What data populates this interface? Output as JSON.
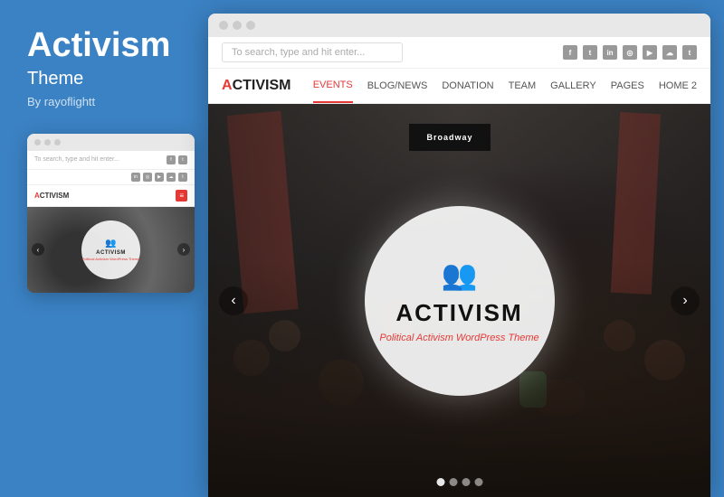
{
  "left_panel": {
    "title": "Activism",
    "subtitle": "Theme",
    "author": "By rayoflightt"
  },
  "mini_browser": {
    "dots": [
      "dot1",
      "dot2",
      "dot3"
    ],
    "search_placeholder": "To search, type and hit enter...",
    "logo": "ACTIVISM",
    "logo_accent": "A",
    "nav_label": "≡",
    "hero": {
      "title": "ACTIVISM",
      "subtitle": "Political Activism WordPress Theme",
      "icon": "👥"
    },
    "arrow_left": "‹",
    "arrow_right": "›"
  },
  "browser": {
    "dots": [
      "dot1",
      "dot2",
      "dot3"
    ],
    "search_placeholder": "To search, type and hit enter...",
    "social_icons": [
      "f",
      "t",
      "in",
      "◎",
      "▶",
      "⬛",
      "t"
    ],
    "logo": "ACTIVISM",
    "logo_accent": "A",
    "nav_links": [
      {
        "label": "EVENTS",
        "active": true
      },
      {
        "label": "BLOG/NEWS",
        "active": false
      },
      {
        "label": "DONATION",
        "active": false
      },
      {
        "label": "TEAM",
        "active": false
      },
      {
        "label": "GALLERY",
        "active": false
      },
      {
        "label": "PAGES",
        "active": false
      },
      {
        "label": "HOME 2",
        "active": false
      }
    ],
    "hero": {
      "title": "ACTIVISM",
      "subtitle": "Political Activism WordPress Theme",
      "broadway_sign": "Broadway",
      "arrow_left": "‹",
      "arrow_right": "›",
      "dots": [
        true,
        false,
        false,
        false
      ]
    }
  },
  "colors": {
    "accent": "#e53935",
    "background": "#3b82c4",
    "nav_active": "#e53935"
  }
}
